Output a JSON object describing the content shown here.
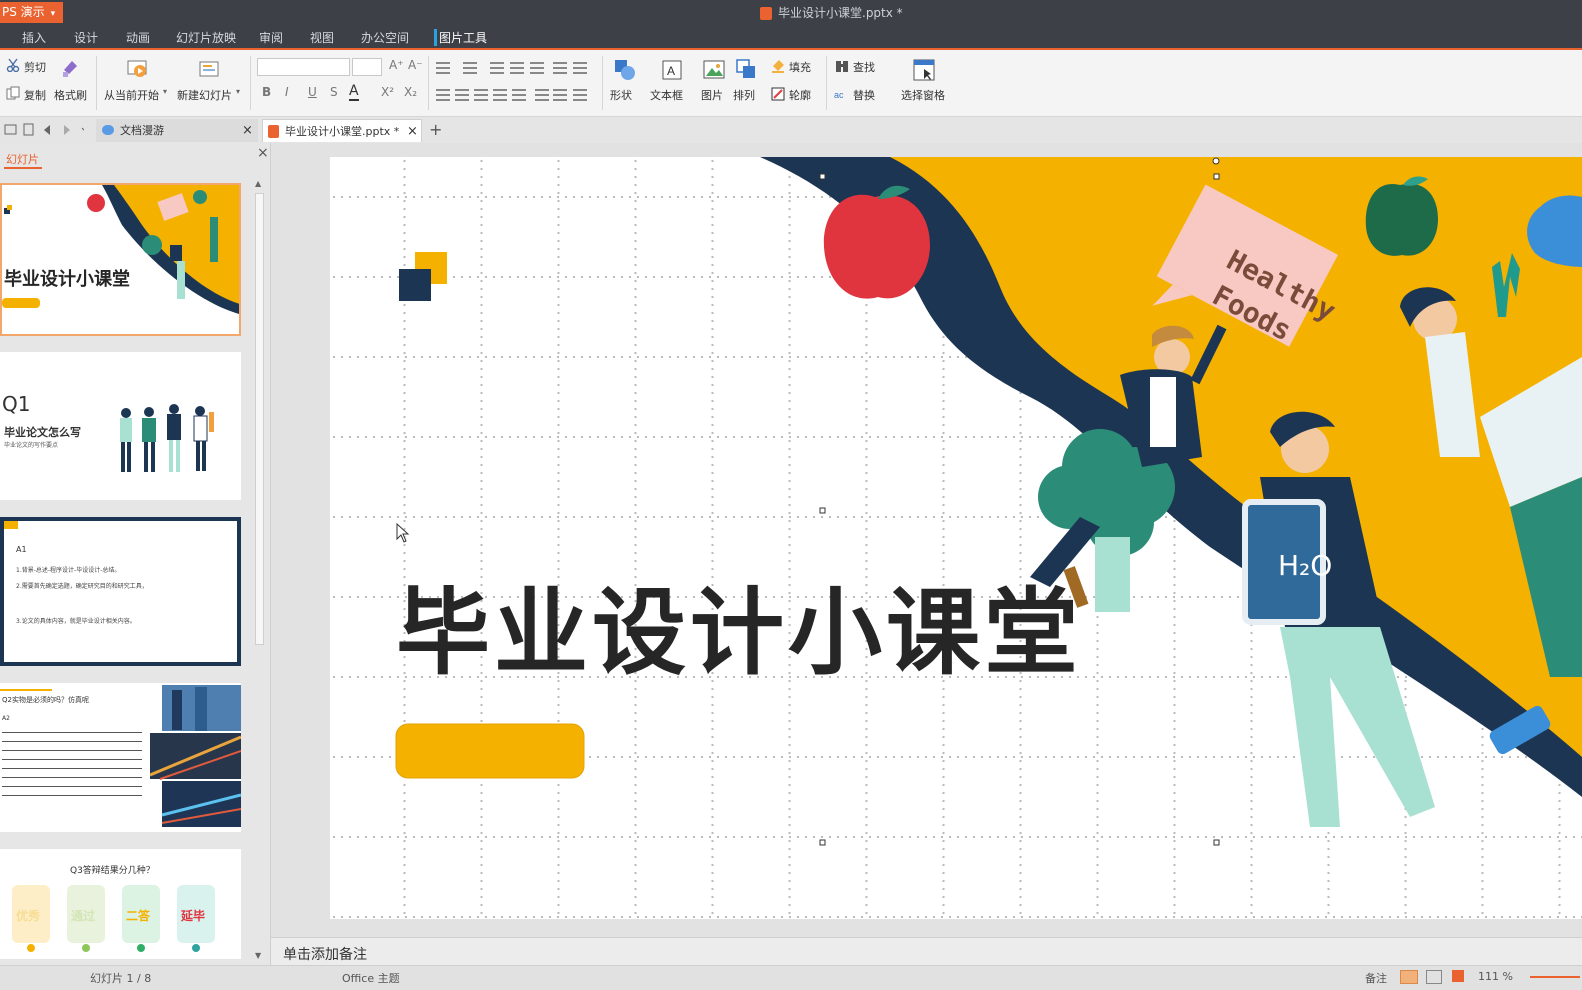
{
  "titlebar": {
    "app_name": "PS 演示",
    "doc_title": "毕业设计小课堂.pptx *"
  },
  "menu": [
    "插入",
    "设计",
    "动画",
    "幻灯片放映",
    "审阅",
    "视图",
    "办公空间",
    "图片工具"
  ],
  "ribbon": {
    "cut": "剪切",
    "copy": "复制",
    "format_painter": "格式刷",
    "play_from_current": "从当前开始",
    "new_slide": "新建幻灯片",
    "shape": "形状",
    "textbox": "文本框",
    "picture": "图片",
    "arrange": "排列",
    "fill": "填充",
    "outline": "轮廓",
    "find": "查找",
    "replace": "替换",
    "select_pane": "选择窗格",
    "bold": "B",
    "italic": "I",
    "underline": "U",
    "strike": "S",
    "font_color": "A",
    "superscript": "X²",
    "subscript": "X₂",
    "grow": "A⁺",
    "shrink": "A⁻"
  },
  "tabs": {
    "cloud": "文档漫游",
    "doc": "毕业设计小课堂.pptx *",
    "add": "+"
  },
  "left_panel": {
    "title": "幻灯片",
    "close": "×",
    "thumbs": [
      {
        "title": "毕业设计小课堂",
        "label": "Healthy Foods"
      },
      {
        "title": "Q1",
        "subtitle": "毕业论文怎么写",
        "caption": "毕业论文的写作要点"
      },
      {
        "title": "A1",
        "lines": [
          "1.背景-总述-程序设计-毕设设计-总结。",
          "2.需要首先确定选题，确定研究目的和研究工具，",
          "3.论文的具体内容，就是毕业设计相关内容。"
        ]
      },
      {
        "title": "Q2实物是必须的吗？仿真呢",
        "sub": "A2"
      },
      {
        "title": "Q3答辩结果分几种？",
        "items": [
          "优秀",
          "通过",
          "二答",
          "延毕"
        ]
      }
    ]
  },
  "slide": {
    "title": "毕业设计小课堂",
    "bubble_line1": "Healthy",
    "bubble_line2": "Foods",
    "bottle_text": "H₂O"
  },
  "colors": {
    "accent": "#e9622f",
    "orange": "#f5b100",
    "navy": "#1c3553",
    "teal": "#2b8c78",
    "mint": "#a8e0d2",
    "pink": "#f8c9c2",
    "red": "#e0353f"
  },
  "notes": {
    "placeholder": "单击添加备注"
  },
  "status": {
    "slide_counter": "幻灯片 1 / 8",
    "theme": "Office 主题",
    "notes": "备注",
    "zoom": "111 %"
  }
}
